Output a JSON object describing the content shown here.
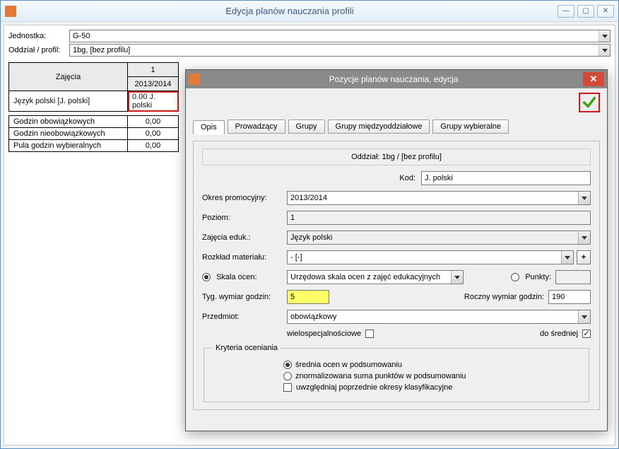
{
  "main_window": {
    "title": "Edycja planów nauczania profili"
  },
  "form": {
    "jednostka_label": "Jednostka:",
    "jednostka_value": "G-50",
    "oddzial_label": "Oddział / profil:",
    "oddzial_value": "1bg, [bez profilu]"
  },
  "table": {
    "zajecia_header": "Zajęcia",
    "col1_num": "1",
    "col1_year": "2013/2014",
    "rows": {
      "subject_name": "Język polski [J. polski]",
      "subject_hours": "0.00 J. polski",
      "godzin_obow": "Godzin obowiązkowych",
      "godzin_obow_val": "0,00",
      "godzin_nieobow": "Godzin nieobowiązkowych",
      "godzin_nieobow_val": "0,00",
      "pula": "Pula godzin wybieralnych",
      "pula_val": "0,00"
    }
  },
  "dialog": {
    "title": "Pozycje planów nauczania, edycja",
    "tabs": {
      "opis": "Opis",
      "prowadzacy": "Prowadzący",
      "grupy": "Grupy",
      "miedzy": "Grupy międzyoddziałowe",
      "wybieralne": "Grupy wybieralne"
    },
    "panel_header": "Oddział: 1bg / [bez profilu]",
    "kod_label": "Kod:",
    "kod_value": "J. polski",
    "okres_label": "Okres promocyjny:",
    "okres_value": "2013/2014",
    "poziom_label": "Poziom:",
    "poziom_value": "1",
    "zajecia_label": "Zajęcia eduk.:",
    "zajecia_value": "Język polski",
    "rozklad_label": "Rozkład materiału:",
    "rozklad_value": "- [-]",
    "skala_label": "Skala ocen:",
    "skala_value": "Urzędowa skala ocen z zajęć edukacyjnych",
    "punkty_label": "Punkty:",
    "tyg_label": "Tyg. wymiar godzin:",
    "tyg_value": "5",
    "roczny_label": "Roczny wymiar godzin:",
    "roczny_value": "190",
    "przedmiot_label": "Przedmiot:",
    "przedmiot_value": "obowiązkowy",
    "wielospec_label": "wielospecjalnościowe",
    "dosredniej_label": "do średniej",
    "kryteria_legend": "Kryteria oceniania",
    "krit_srednia": "średnia ocen w podsumowaniu",
    "krit_znorm": "znormalizowana suma punktów w podsumowaniu",
    "krit_uwzgl": "uwzględniaj poprzednie okresy klasyfikacyjne"
  }
}
